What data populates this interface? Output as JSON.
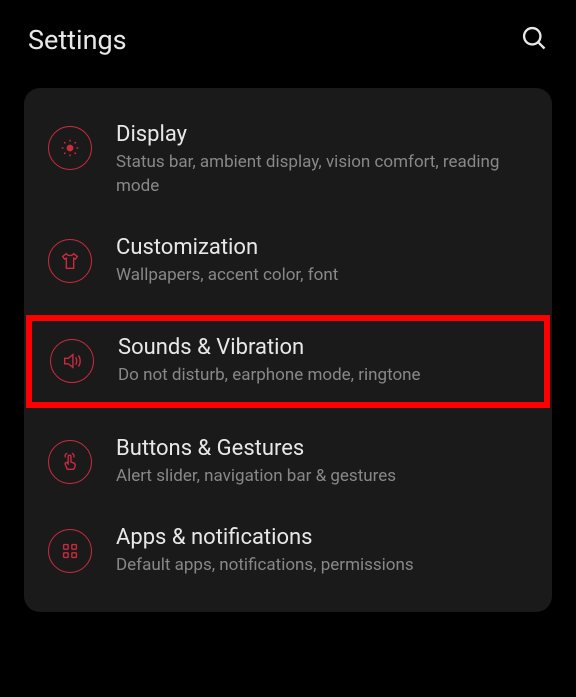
{
  "header": {
    "title": "Settings"
  },
  "items": [
    {
      "icon": "brightness",
      "title": "Display",
      "subtitle": "Status bar, ambient display, vision comfort, reading mode",
      "highlighted": false
    },
    {
      "icon": "shirt",
      "title": "Customization",
      "subtitle": "Wallpapers, accent color, font",
      "highlighted": false
    },
    {
      "icon": "sound",
      "title": "Sounds & Vibration",
      "subtitle": "Do not disturb, earphone mode, ringtone",
      "highlighted": true
    },
    {
      "icon": "touch",
      "title": "Buttons & Gestures",
      "subtitle": "Alert slider, navigation bar & gestures",
      "highlighted": false
    },
    {
      "icon": "apps",
      "title": "Apps & notifications",
      "subtitle": "Default apps, notifications, permissions",
      "highlighted": false
    }
  ],
  "accent_color": "#cc2b3f"
}
